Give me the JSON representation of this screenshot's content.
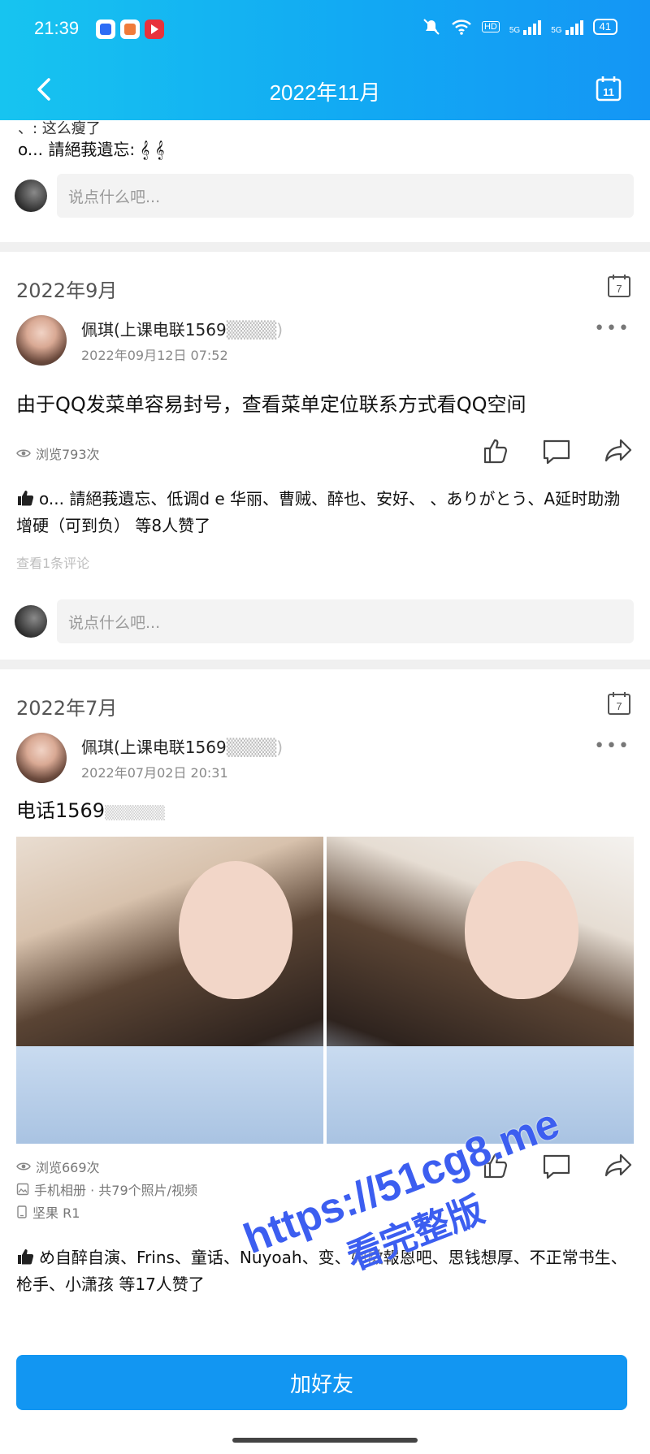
{
  "status_bar": {
    "time": "21:39",
    "signal1": "5G",
    "signal2": "5G",
    "hd": "HD",
    "battery": "41"
  },
  "nav": {
    "title": "2022年11月",
    "calendar_day": "11"
  },
  "prev_post_remnant": {
    "line1": "、: 这么瘦了",
    "line2": "o... 請絕莪遺忘: 𝄞 𝄞",
    "comment_placeholder": "说点什么吧..."
  },
  "posts": [
    {
      "month": "2022年9月",
      "calendar_day": "7",
      "author": "佩琪(上课电联1569",
      "author_suffix": "▒▒▒▒)",
      "date": "2022年09月12日 07:52",
      "text": "由于QQ发菜单容易封号，查看菜单定位联系方式看QQ空间",
      "views": "浏览793次",
      "likes": "o... 請絕莪遺忘、低调d e 华丽、曹贼、醉也、安好、 、ありがとう、A延时助渤增硬（可到负） 等8人赞了",
      "view_comments": "查看1条评论",
      "comment_placeholder": "说点什么吧..."
    },
    {
      "month": "2022年7月",
      "calendar_day": "7",
      "author": "佩琪(上课电联1569",
      "author_suffix": "▒▒▒▒)",
      "date": "2022年07月02日 20:31",
      "text": "电话1569",
      "text_suffix": "▒▒▒▒▒▒",
      "views": "浏览669次",
      "album": "手机相册 · 共79个照片/视频",
      "device": "坚果 R1",
      "likes": "め自醉自演、Frins、童话、Nuyoah、变、妳傚報恩吧、思钱想厚、不正常书生、枪手、小潇孩 等17人赞了"
    }
  ],
  "add_friend_button": "加好友",
  "watermark": {
    "line1": "https://51cg8.me",
    "line2": "看完整版"
  }
}
